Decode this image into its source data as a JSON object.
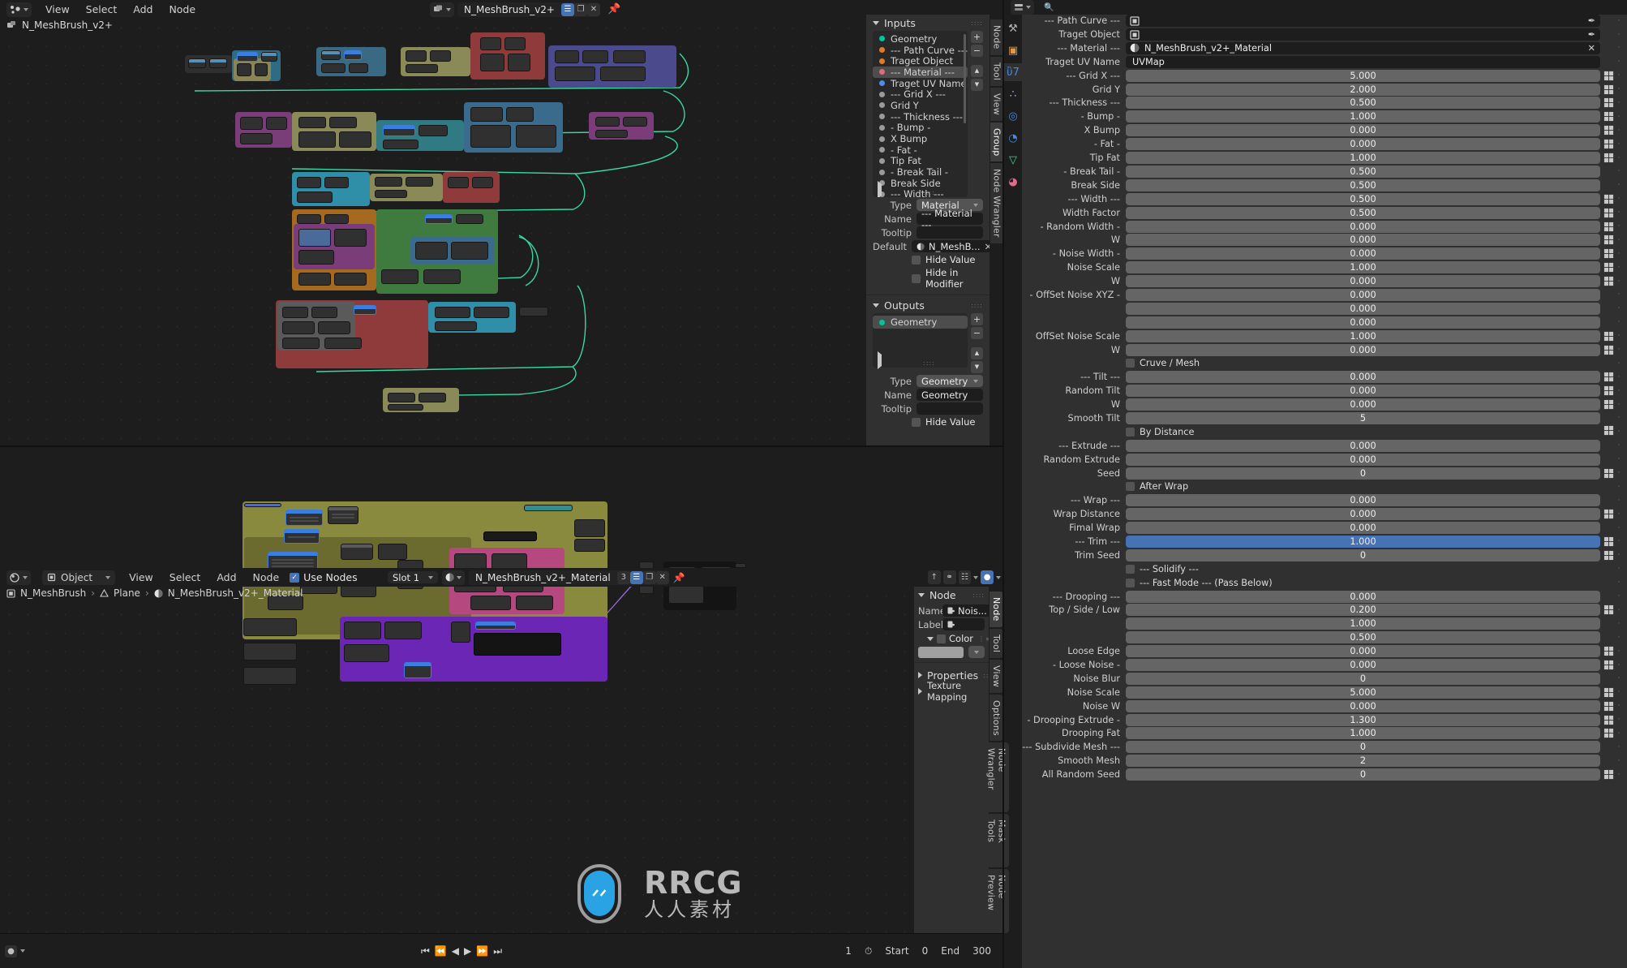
{
  "geo_editor": {
    "menus": [
      "View",
      "Select",
      "Add",
      "Node"
    ],
    "editor_type_icon": "geometry-nodes-editor-icon",
    "breadcrumb": "N_MeshBrush_v2+",
    "breadcrumb_icon": "nodetree-icon",
    "header_id": {
      "browse_icon": "browse-nodetree-icon",
      "name": "N_MeshBrush_v2+",
      "fake_user_icon": "fake-user-icon",
      "new_icon": "duplicate-icon",
      "unlink_icon": "x-icon",
      "pin_icon": "pin-icon"
    }
  },
  "inputs_panel": {
    "title": "Inputs",
    "items": [
      {
        "label": "Geometry",
        "color": "#00c79b"
      },
      {
        "label": "--- Path Curve ---",
        "color": "#e07a2f"
      },
      {
        "label": "Traget Object",
        "color": "#e07a2f"
      },
      {
        "label": "--- Material ---",
        "color": "#e06a7e",
        "selected": true
      },
      {
        "label": "Traget UV Name",
        "color": "#4c8ef0"
      },
      {
        "label": "--- Grid X ---",
        "color": "#9a9a9a"
      },
      {
        "label": "Grid Y",
        "color": "#9a9a9a"
      },
      {
        "label": "--- Thickness ---",
        "color": "#9a9a9a"
      },
      {
        "label": "- Bump -",
        "color": "#9a9a9a"
      },
      {
        "label": "X Bump",
        "color": "#9a9a9a"
      },
      {
        "label": "- Fat -",
        "color": "#9a9a9a"
      },
      {
        "label": "Tip Fat",
        "color": "#9a9a9a"
      },
      {
        "label": "- Break Tail -",
        "color": "#9a9a9a"
      },
      {
        "label": "Break Side",
        "color": "#9a9a9a"
      },
      {
        "label": "--- Width ---",
        "color": "#9a9a9a"
      }
    ],
    "buttons": {
      "add": "+",
      "remove": "−",
      "move_up": "▲",
      "move_down": "▼"
    },
    "type_label": "Type",
    "type_value": "Material",
    "name_label": "Name",
    "name_value": "--- Material ---",
    "tooltip_label": "Tooltip",
    "tooltip_value": "",
    "default_label": "Default",
    "default_value": "N_MeshB...",
    "default_icon": "material-icon",
    "default_clear_icon": "x-icon",
    "hide_value_label": "Hide Value",
    "hide_in_modifier_label": "Hide in Modifier"
  },
  "outputs_panel": {
    "title": "Outputs",
    "items": [
      {
        "label": "Geometry",
        "color": "#00c79b",
        "selected": true
      }
    ],
    "type_label": "Type",
    "type_value": "Geometry",
    "name_label": "Name",
    "name_value": "Geometry",
    "tooltip_label": "Tooltip",
    "tooltip_value": "",
    "hide_value_label": "Hide Value"
  },
  "geo_vtabs": [
    "Node",
    "Tool",
    "View",
    "Group",
    "Node Wrangler"
  ],
  "properties_tabs": [
    {
      "icon": "tool-icon",
      "name": "tool-properties-tab"
    },
    {
      "icon": "object-icon",
      "name": "object-properties-tab"
    },
    {
      "icon": "wrench-icon",
      "name": "modifier-properties-tab",
      "active": true
    },
    {
      "icon": "particles-icon",
      "name": "particle-properties-tab"
    },
    {
      "icon": "physics-icon",
      "name": "physics-properties-tab"
    },
    {
      "icon": "constraint-icon",
      "name": "constraint-properties-tab"
    },
    {
      "icon": "data-icon",
      "name": "object-data-tab"
    },
    {
      "icon": "material-icon",
      "name": "material-properties-tab"
    }
  ],
  "modifier_props": [
    {
      "label": "--- Path Curve ---",
      "value": "",
      "type": "object"
    },
    {
      "label": "Traget Object",
      "value": "",
      "type": "object"
    },
    {
      "label": "--- Material ---",
      "value": "N_MeshBrush_v2+_Material",
      "type": "material"
    },
    {
      "label": "Traget UV Name",
      "value": "UVMap",
      "type": "text"
    },
    {
      "label": "--- Grid X ---",
      "value": "5.000",
      "type": "num",
      "anim": true
    },
    {
      "label": "Grid Y",
      "value": "2.000",
      "type": "num",
      "anim": true
    },
    {
      "label": "--- Thickness ---",
      "value": "0.500",
      "type": "num",
      "anim": true
    },
    {
      "label": "- Bump -",
      "value": "1.000",
      "type": "num",
      "anim": true
    },
    {
      "label": "X Bump",
      "value": "0.000",
      "type": "num",
      "anim": true
    },
    {
      "label": "- Fat -",
      "value": "0.000",
      "type": "num",
      "anim": true
    },
    {
      "label": "Tip Fat",
      "value": "1.000",
      "type": "num",
      "anim": true
    },
    {
      "label": "- Break Tail -",
      "value": "0.500",
      "type": "num"
    },
    {
      "label": "Break Side",
      "value": "0.500",
      "type": "num"
    },
    {
      "label": "--- Width ---",
      "value": "0.500",
      "type": "num",
      "anim": true
    },
    {
      "label": "Width Factor",
      "value": "0.500",
      "type": "num",
      "anim": true
    },
    {
      "label": "- Random Width -",
      "value": "0.000",
      "type": "num",
      "anim": true
    },
    {
      "label": "W",
      "value": "0.000",
      "type": "num",
      "anim": true
    },
    {
      "label": "- Noise Width -",
      "value": "0.000",
      "type": "num",
      "anim": true
    },
    {
      "label": "Noise Scale",
      "value": "1.000",
      "type": "num",
      "anim": true
    },
    {
      "label": "W",
      "value": "0.000",
      "type": "num",
      "anim": true
    },
    {
      "label": "- OffSet Noise XYZ -",
      "value": "0.000",
      "type": "num"
    },
    {
      "label": "",
      "value": "0.000",
      "type": "num"
    },
    {
      "label": "",
      "value": "0.000",
      "type": "num"
    },
    {
      "label": "OffSet Noise Scale",
      "value": "1.000",
      "type": "num",
      "anim": true
    },
    {
      "label": "W",
      "value": "0.000",
      "type": "num",
      "anim": true
    },
    {
      "label": "Cruve / Mesh",
      "value": "",
      "type": "check"
    },
    {
      "label": "--- Tilt ---",
      "value": "0.000",
      "type": "num",
      "anim": true
    },
    {
      "label": "Random Tilt",
      "value": "0.000",
      "type": "num",
      "anim": true
    },
    {
      "label": "W",
      "value": "0.000",
      "type": "num",
      "anim": true
    },
    {
      "label": "Smooth Tilt",
      "value": "5",
      "type": "num"
    },
    {
      "label": "By Distance",
      "value": "",
      "type": "check",
      "anim": true
    },
    {
      "label": "--- Extrude ---",
      "value": "0.000",
      "type": "num"
    },
    {
      "label": "Random Extrude",
      "value": "0.000",
      "type": "num"
    },
    {
      "label": "Seed",
      "value": "0",
      "type": "num",
      "anim": true
    },
    {
      "label": "After Wrap",
      "value": "",
      "type": "check"
    },
    {
      "label": "--- Wrap ---",
      "value": "0.000",
      "type": "num"
    },
    {
      "label": "Wrap Distance",
      "value": "0.000",
      "type": "num",
      "anim": true
    },
    {
      "label": "Fimal Wrap",
      "value": "0.000",
      "type": "num"
    },
    {
      "label": "--- Trim ---",
      "value": "1.000",
      "type": "slider",
      "anim": true
    },
    {
      "label": "Trim Seed",
      "value": "0",
      "type": "num",
      "anim": true
    },
    {
      "label": "--- Solidify ---",
      "value": "",
      "type": "check"
    },
    {
      "label": "--- Fast Mode --- (Pass Below)",
      "value": "",
      "type": "check"
    },
    {
      "label": "--- Drooping ---",
      "value": "0.000",
      "type": "num"
    },
    {
      "label": "Top / Side / Low",
      "value": "0.200",
      "type": "num",
      "anim": true
    },
    {
      "label": "",
      "value": "1.000",
      "type": "num"
    },
    {
      "label": "",
      "value": "0.500",
      "type": "num"
    },
    {
      "label": "Loose Edge",
      "value": "0.000",
      "type": "num",
      "anim": true
    },
    {
      "label": "- Loose Noise -",
      "value": "0.000",
      "type": "num",
      "anim": true
    },
    {
      "label": "Noise Blur",
      "value": "0",
      "type": "num"
    },
    {
      "label": "Noise Scale",
      "value": "5.000",
      "type": "num",
      "anim": true
    },
    {
      "label": "Noise W",
      "value": "0.000",
      "type": "num",
      "anim": true
    },
    {
      "label": "- Drooping Extrude -",
      "value": "1.300",
      "type": "num",
      "anim": true
    },
    {
      "label": "Drooping Fat",
      "value": "1.000",
      "type": "num",
      "anim": true
    },
    {
      "label": "--- Subdivide Mesh ---",
      "value": "0",
      "type": "num"
    },
    {
      "label": "Smooth Mesh",
      "value": "2",
      "type": "num"
    },
    {
      "label": "All Random Seed",
      "value": "0",
      "type": "num",
      "anim": true
    }
  ],
  "shader_editor": {
    "shading_type_icon": "shading-type-icon",
    "object_selector": "Object",
    "object_icon": "object-icon",
    "menus": [
      "View",
      "Select",
      "Add",
      "Node"
    ],
    "use_nodes_label": "Use Nodes",
    "use_nodes_checked": true,
    "slot_label": "Slot 1",
    "material_browse_icon": "material-icon",
    "material_name": "N_MeshBrush_v2+_Material",
    "material_users": "3",
    "fake_user_icon": "fake-user-icon",
    "new_material_icon": "duplicate-icon",
    "unlink_icon": "x-icon",
    "pin_icon": "pin-icon",
    "breadcrumb": [
      {
        "icon": "object-icon",
        "label": "N_MeshBrush"
      },
      {
        "icon": "mesh-data-icon",
        "label": "Plane"
      },
      {
        "icon": "material-icon",
        "label": "N_MeshBrush_v2+_Material"
      }
    ],
    "snap_icons": [
      "overlay-arrow-icon",
      "snap-magnet-icon",
      "snap-target-icon",
      "shading-sphere-icon"
    ]
  },
  "node_panel": {
    "title": "Node",
    "name_label": "Name:",
    "name_value": "Nois...",
    "name_icon": "node-icon",
    "label_label": "Label:",
    "label_value": "",
    "color_label": "Color",
    "color_swatch": "#a0a0a0",
    "properties_title": "Properties",
    "texture_mapping_title": "Texture Mapping"
  },
  "shader_vtabs": [
    "Node",
    "Tool",
    "View",
    "Options",
    "Node Wrangler",
    "Mask Tools",
    "Node Preview"
  ],
  "timeline": {
    "current_frame": "1",
    "start_label": "Start",
    "start_value": "0",
    "end_label": "End",
    "end_value": "300",
    "playback_icons": [
      "jump-start-icon",
      "prev-keyframe-icon",
      "play-reverse-icon",
      "play-icon",
      "next-keyframe-icon",
      "jump-end-icon"
    ],
    "keying_icon": "record-icon",
    "timer_icon": "timer-icon"
  },
  "watermark": {
    "text": "RRCG",
    "subtext": "人人素材",
    "color": "#29a3e3"
  },
  "colors": {
    "accent_blue": "#4772b3",
    "panel_bg": "#303030",
    "editor_bg": "#1d1d1d",
    "field_bg": "#545454"
  }
}
